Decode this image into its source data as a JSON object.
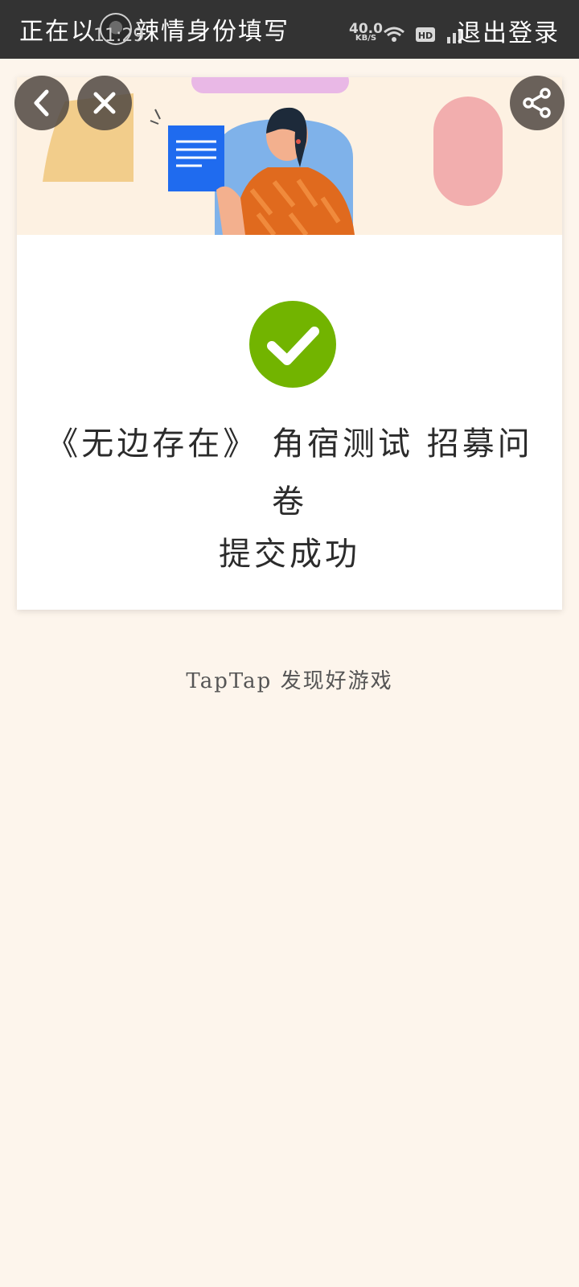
{
  "topbar": {
    "prefix": "正在以",
    "suffix": "辣情身份填写",
    "logout": "退出登录",
    "status_time": "11:29",
    "net_speed": "40.0",
    "net_unit": "KB/S"
  },
  "result": {
    "title_line1": "《无边存在》 角宿测试 招募问",
    "title_line2": "卷",
    "status": "提交成功"
  },
  "footer": {
    "text": "TapTap 发现好游戏"
  },
  "icons": {
    "back": "chevron-left-icon",
    "close": "close-icon",
    "share": "share-icon",
    "success": "check-circle-icon"
  },
  "colors": {
    "accent_green": "#72b400",
    "topbar": "#333333",
    "page_bg": "#fdf5ec"
  }
}
